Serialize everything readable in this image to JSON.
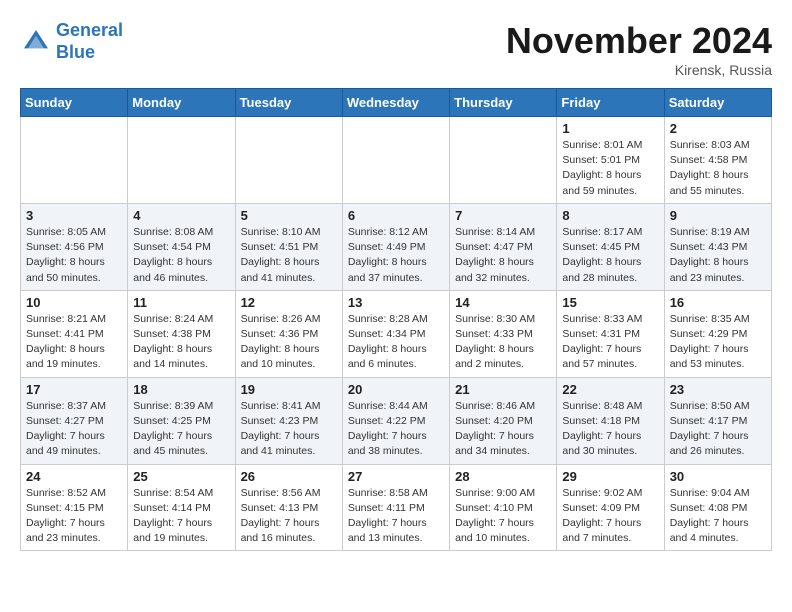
{
  "header": {
    "logo_line1": "General",
    "logo_line2": "Blue",
    "month_title": "November 2024",
    "location": "Kirensk, Russia"
  },
  "weekdays": [
    "Sunday",
    "Monday",
    "Tuesday",
    "Wednesday",
    "Thursday",
    "Friday",
    "Saturday"
  ],
  "weeks": [
    [
      {
        "day": "",
        "info": ""
      },
      {
        "day": "",
        "info": ""
      },
      {
        "day": "",
        "info": ""
      },
      {
        "day": "",
        "info": ""
      },
      {
        "day": "",
        "info": ""
      },
      {
        "day": "1",
        "info": "Sunrise: 8:01 AM\nSunset: 5:01 PM\nDaylight: 8 hours and 59 minutes."
      },
      {
        "day": "2",
        "info": "Sunrise: 8:03 AM\nSunset: 4:58 PM\nDaylight: 8 hours and 55 minutes."
      }
    ],
    [
      {
        "day": "3",
        "info": "Sunrise: 8:05 AM\nSunset: 4:56 PM\nDaylight: 8 hours and 50 minutes."
      },
      {
        "day": "4",
        "info": "Sunrise: 8:08 AM\nSunset: 4:54 PM\nDaylight: 8 hours and 46 minutes."
      },
      {
        "day": "5",
        "info": "Sunrise: 8:10 AM\nSunset: 4:51 PM\nDaylight: 8 hours and 41 minutes."
      },
      {
        "day": "6",
        "info": "Sunrise: 8:12 AM\nSunset: 4:49 PM\nDaylight: 8 hours and 37 minutes."
      },
      {
        "day": "7",
        "info": "Sunrise: 8:14 AM\nSunset: 4:47 PM\nDaylight: 8 hours and 32 minutes."
      },
      {
        "day": "8",
        "info": "Sunrise: 8:17 AM\nSunset: 4:45 PM\nDaylight: 8 hours and 28 minutes."
      },
      {
        "day": "9",
        "info": "Sunrise: 8:19 AM\nSunset: 4:43 PM\nDaylight: 8 hours and 23 minutes."
      }
    ],
    [
      {
        "day": "10",
        "info": "Sunrise: 8:21 AM\nSunset: 4:41 PM\nDaylight: 8 hours and 19 minutes."
      },
      {
        "day": "11",
        "info": "Sunrise: 8:24 AM\nSunset: 4:38 PM\nDaylight: 8 hours and 14 minutes."
      },
      {
        "day": "12",
        "info": "Sunrise: 8:26 AM\nSunset: 4:36 PM\nDaylight: 8 hours and 10 minutes."
      },
      {
        "day": "13",
        "info": "Sunrise: 8:28 AM\nSunset: 4:34 PM\nDaylight: 8 hours and 6 minutes."
      },
      {
        "day": "14",
        "info": "Sunrise: 8:30 AM\nSunset: 4:33 PM\nDaylight: 8 hours and 2 minutes."
      },
      {
        "day": "15",
        "info": "Sunrise: 8:33 AM\nSunset: 4:31 PM\nDaylight: 7 hours and 57 minutes."
      },
      {
        "day": "16",
        "info": "Sunrise: 8:35 AM\nSunset: 4:29 PM\nDaylight: 7 hours and 53 minutes."
      }
    ],
    [
      {
        "day": "17",
        "info": "Sunrise: 8:37 AM\nSunset: 4:27 PM\nDaylight: 7 hours and 49 minutes."
      },
      {
        "day": "18",
        "info": "Sunrise: 8:39 AM\nSunset: 4:25 PM\nDaylight: 7 hours and 45 minutes."
      },
      {
        "day": "19",
        "info": "Sunrise: 8:41 AM\nSunset: 4:23 PM\nDaylight: 7 hours and 41 minutes."
      },
      {
        "day": "20",
        "info": "Sunrise: 8:44 AM\nSunset: 4:22 PM\nDaylight: 7 hours and 38 minutes."
      },
      {
        "day": "21",
        "info": "Sunrise: 8:46 AM\nSunset: 4:20 PM\nDaylight: 7 hours and 34 minutes."
      },
      {
        "day": "22",
        "info": "Sunrise: 8:48 AM\nSunset: 4:18 PM\nDaylight: 7 hours and 30 minutes."
      },
      {
        "day": "23",
        "info": "Sunrise: 8:50 AM\nSunset: 4:17 PM\nDaylight: 7 hours and 26 minutes."
      }
    ],
    [
      {
        "day": "24",
        "info": "Sunrise: 8:52 AM\nSunset: 4:15 PM\nDaylight: 7 hours and 23 minutes."
      },
      {
        "day": "25",
        "info": "Sunrise: 8:54 AM\nSunset: 4:14 PM\nDaylight: 7 hours and 19 minutes."
      },
      {
        "day": "26",
        "info": "Sunrise: 8:56 AM\nSunset: 4:13 PM\nDaylight: 7 hours and 16 minutes."
      },
      {
        "day": "27",
        "info": "Sunrise: 8:58 AM\nSunset: 4:11 PM\nDaylight: 7 hours and 13 minutes."
      },
      {
        "day": "28",
        "info": "Sunrise: 9:00 AM\nSunset: 4:10 PM\nDaylight: 7 hours and 10 minutes."
      },
      {
        "day": "29",
        "info": "Sunrise: 9:02 AM\nSunset: 4:09 PM\nDaylight: 7 hours and 7 minutes."
      },
      {
        "day": "30",
        "info": "Sunrise: 9:04 AM\nSunset: 4:08 PM\nDaylight: 7 hours and 4 minutes."
      }
    ]
  ]
}
